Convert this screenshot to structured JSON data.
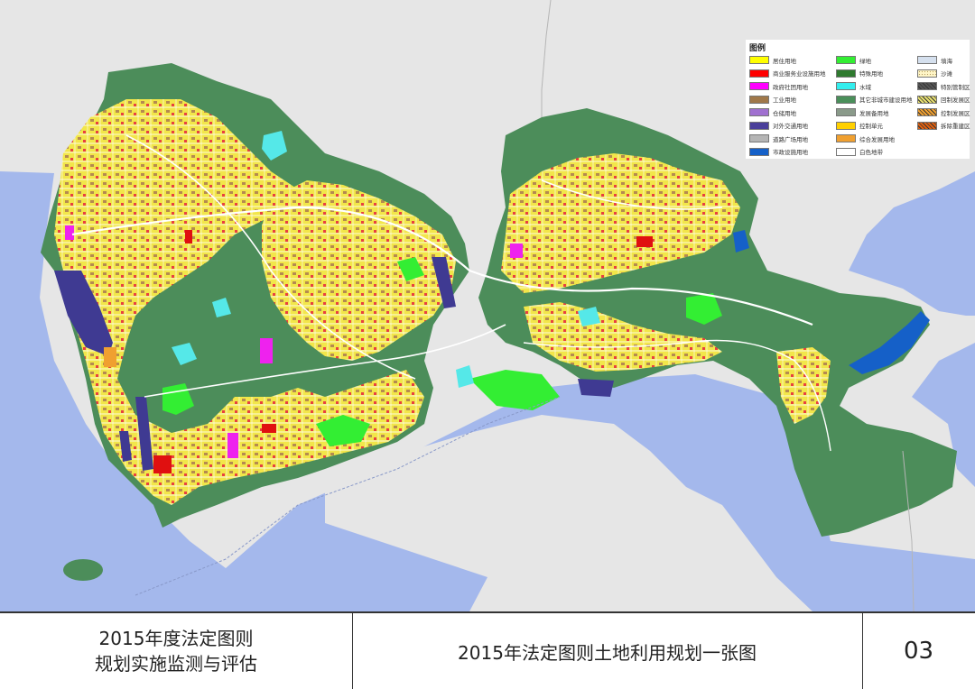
{
  "legend": {
    "title": "图例",
    "items": [
      {
        "label": "居住用地",
        "color": "#ffff00",
        "pattern": "solid"
      },
      {
        "label": "商业服务业设施用地",
        "color": "#ff0000",
        "pattern": "solid"
      },
      {
        "label": "政府社团用地",
        "color": "#ff00ff",
        "pattern": "solid"
      },
      {
        "label": "工业用地",
        "color": "#a0784a",
        "pattern": "solid"
      },
      {
        "label": "仓储用地",
        "color": "#a070d0",
        "pattern": "solid"
      },
      {
        "label": "对外交通用地",
        "color": "#4a3f9a",
        "pattern": "solid"
      },
      {
        "label": "道路广场用地",
        "color": "#b5b5b5",
        "pattern": "solid"
      },
      {
        "label": "市政设施用地",
        "color": "#1560c8",
        "pattern": "solid"
      },
      {
        "label": "绿地",
        "color": "#33ee33",
        "pattern": "solid"
      },
      {
        "label": "特殊用地",
        "color": "#2f7a2f",
        "pattern": "solid"
      },
      {
        "label": "水域",
        "color": "#33eeee",
        "pattern": "solid"
      },
      {
        "label": "其它非城市建设用地",
        "color": "#4a8f5a",
        "pattern": "solid"
      },
      {
        "label": "发展备用地",
        "color": "#8a9a8a",
        "pattern": "solid"
      },
      {
        "label": "控制单元",
        "color": "#ffd000",
        "pattern": "solid"
      },
      {
        "label": "综合发展用地",
        "color": "#f0a030",
        "pattern": "solid"
      },
      {
        "label": "白色地带",
        "color": "#ffffff",
        "pattern": "solid"
      },
      {
        "label": "填海",
        "color": "#d5e0ee",
        "pattern": "solid"
      },
      {
        "label": "沙滩",
        "color": "#fff6c8",
        "pattern": "dots"
      },
      {
        "label": "特别管制区",
        "color": "#555555",
        "pattern": "hatch"
      },
      {
        "label": "回制发展区",
        "color": "#e8e070",
        "pattern": "hatch"
      },
      {
        "label": "控制发展区",
        "color": "#f0a030",
        "pattern": "hatch"
      },
      {
        "label": "拆除重建区",
        "color": "#e06010",
        "pattern": "hatch"
      }
    ]
  },
  "map_colors": {
    "sea": "#a4b8ec",
    "land": "#e6e6e6",
    "forest": "#4c8d5a",
    "urban": "#f2e64a",
    "green": "#33ee33",
    "water": "#55e8e8",
    "port": "#3f3a92",
    "utility": "#1560c8",
    "commercial": "#e01010",
    "government": "#ee22ee",
    "road": "#ffffff"
  },
  "footer": {
    "left_line1": "2015年度法定图则",
    "left_line2": "规划实施监测与评估",
    "center_title": "2015年法定图则土地利用规划一张图",
    "page_number": "03"
  }
}
